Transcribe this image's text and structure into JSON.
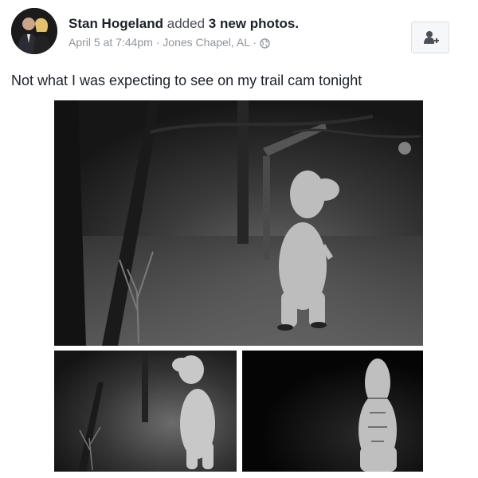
{
  "post": {
    "author": "Stan Hogeland",
    "action_prefix": "added",
    "photo_count": "3 new photos.",
    "date": "April 5 at 7:44pm",
    "separator": "·",
    "location": "Jones Chapel, AL",
    "privacy_icon": "globe-icon",
    "caption": "Not what I was expecting to see on my trail cam tonight"
  },
  "actions": {
    "add_friend_icon": "add-friend-icon"
  },
  "photos": [
    {
      "subject": "person in inflatable T-rex costume, trail cam night shot"
    },
    {
      "subject": "inflatable T-rex costume near trees"
    },
    {
      "subject": "inflatable T-rex costume in darkness"
    }
  ]
}
